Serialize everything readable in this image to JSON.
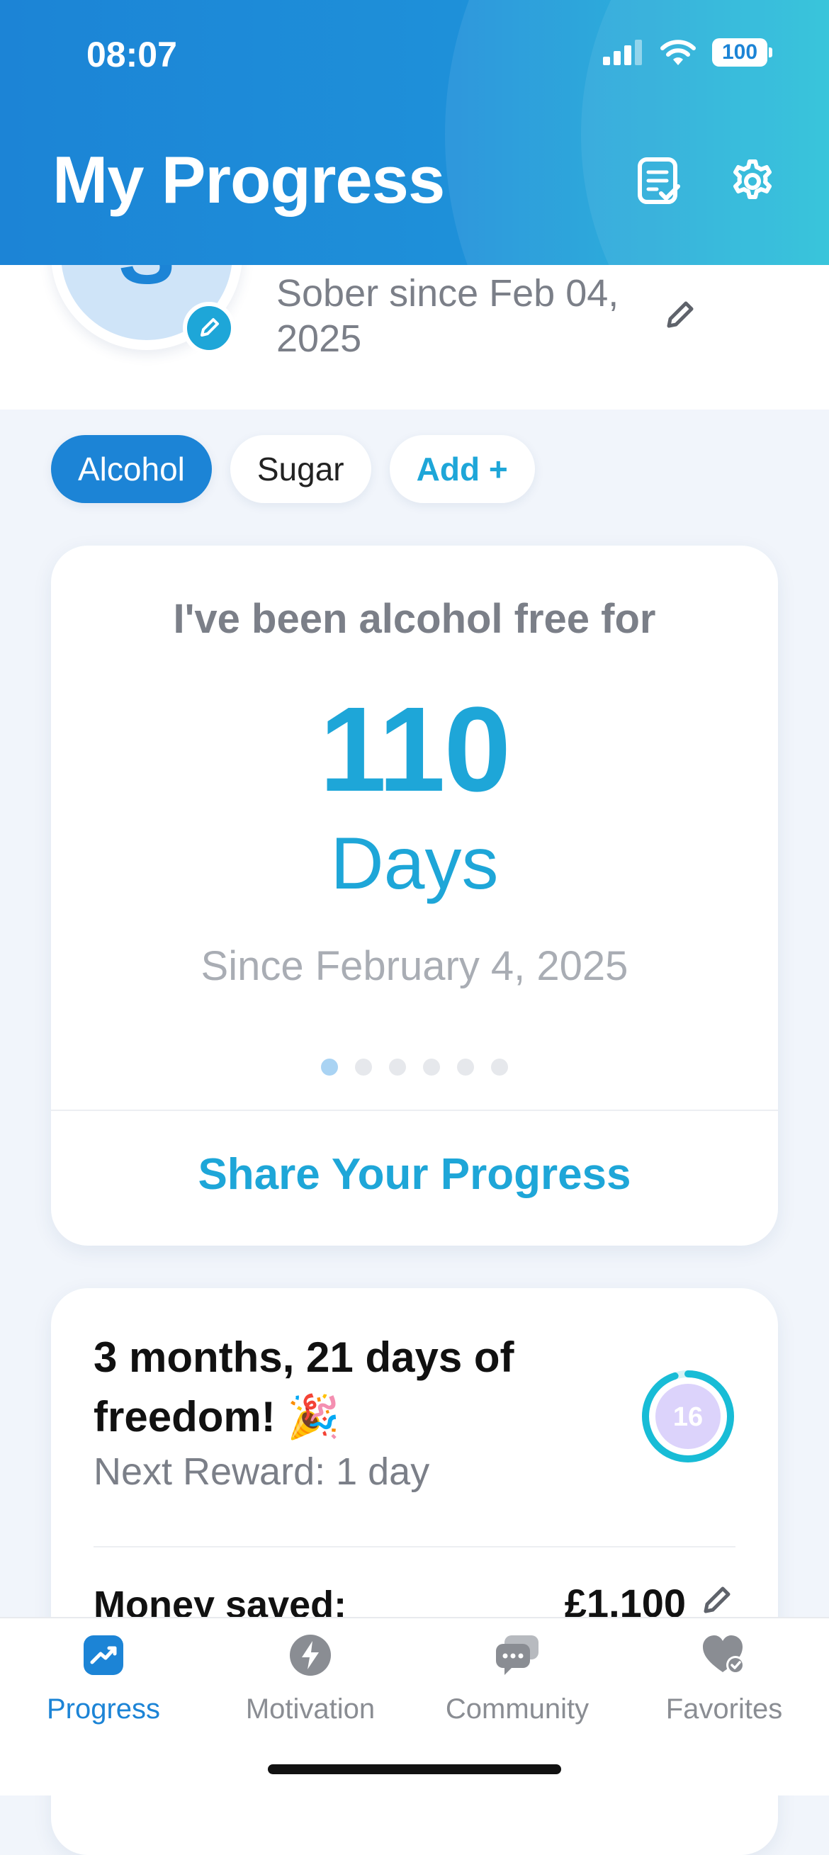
{
  "status_bar": {
    "time": "08:07",
    "battery": "100"
  },
  "header": {
    "title": "My Progress"
  },
  "profile": {
    "avatar_initial": "S",
    "sober_since": "Sober since Feb 04, 2025"
  },
  "chips": {
    "items": [
      "Alcohol",
      "Sugar"
    ],
    "add_label": "Add +"
  },
  "progress_card": {
    "lead": "I've been alcohol free for",
    "count": "110",
    "unit": "Days",
    "since": "Since February 4, 2025",
    "page_count": 6,
    "active_page": 1,
    "share_label": "Share Your Progress"
  },
  "milestone_card": {
    "title": "3 months, 21 days of freedom! 🎉",
    "next_reward": "Next Reward: 1 day",
    "badge_number": "16",
    "badge_progress": 0.95,
    "money_label": "Money saved:",
    "money_value": "£1,100"
  },
  "bottom_nav": {
    "items": [
      {
        "label": "Progress",
        "icon": "trend-chart-icon",
        "active": true
      },
      {
        "label": "Motivation",
        "icon": "lightning-icon",
        "active": false
      },
      {
        "label": "Community",
        "icon": "chat-bubbles-icon",
        "active": false
      },
      {
        "label": "Favorites",
        "icon": "heart-check-icon",
        "active": false
      }
    ]
  },
  "colors": {
    "primary": "#1c84d6",
    "accent": "#1ea6d8",
    "teal": "#18bcd6",
    "background": "#f1f5fb"
  }
}
